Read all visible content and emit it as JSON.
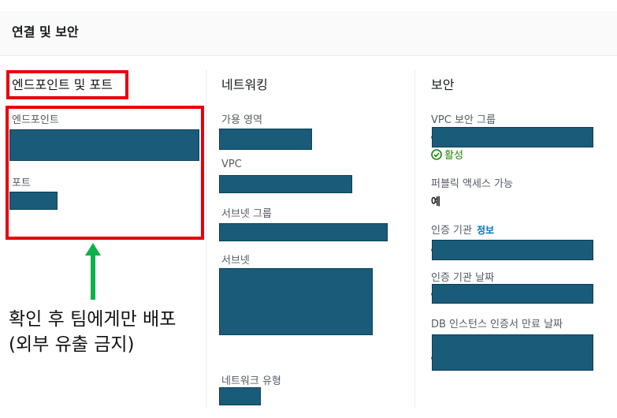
{
  "header": {
    "title": "연결 및 보안"
  },
  "endpoint_section": {
    "title": "엔드포인트 및 포트",
    "endpoint_label": "엔드포인트",
    "port_label": "포트"
  },
  "network_section": {
    "title": "네트워킹",
    "az_label": "가용 영역",
    "vpc_label": "VPC",
    "subnet_group_label": "서브넷 그룹",
    "subnets_label": "서브넷",
    "network_type_label": "네트워크 유형"
  },
  "security_section": {
    "title": "보안",
    "vpc_sg_label": "VPC 보안 그룹",
    "sg_status": "활성",
    "public_access_label": "퍼블릭 액세스 가능",
    "public_access_value": "예",
    "ca_label": "인증 기관",
    "ca_info_link": "정보",
    "ca_date_label": "인증 기관 날짜",
    "cert_expiry_label": "DB 인스턴스 인증서 만료 날짜"
  },
  "annotation": {
    "line1": "확인 후 팀에게만 배포",
    "line2": "(외부 유출 금지)",
    "highlight_color": "#e8000c",
    "arrow_color": "#0db14b"
  },
  "colors": {
    "redaction": "#1a5b7a",
    "status_green": "#1d8102",
    "link": "#0073bb"
  }
}
